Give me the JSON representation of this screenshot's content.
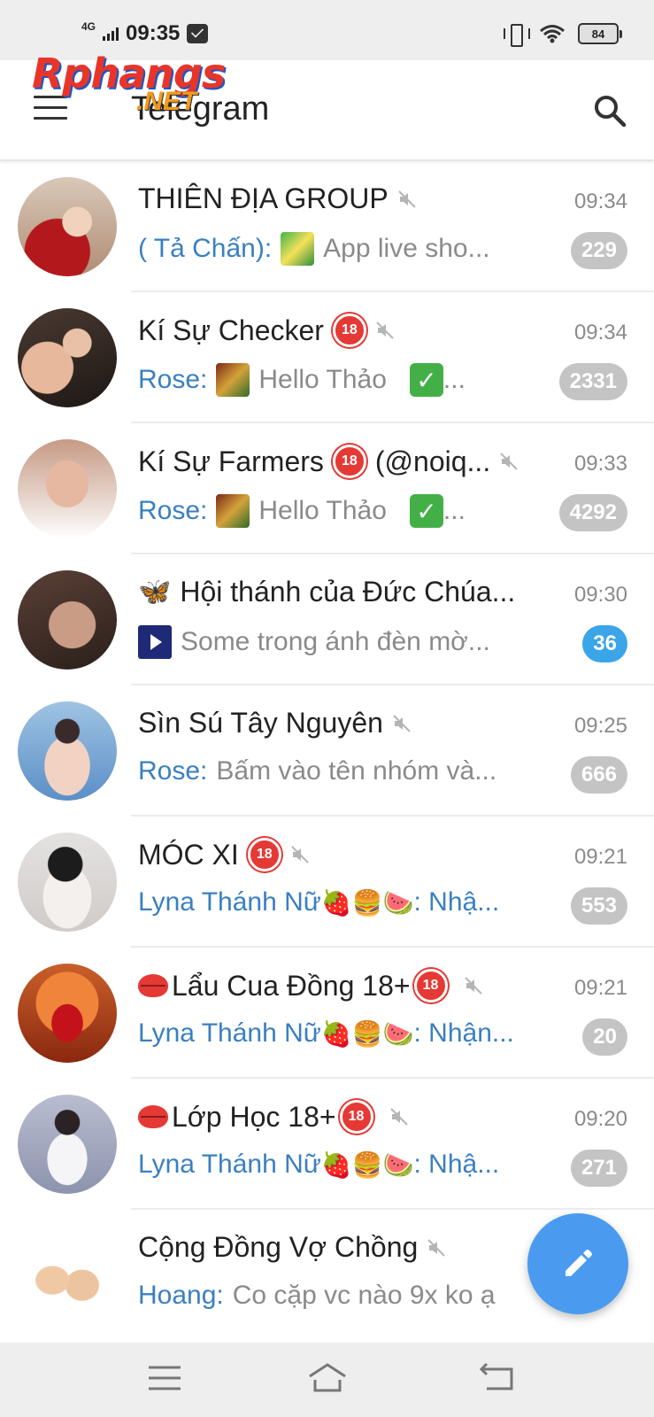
{
  "status_bar": {
    "network": "4G",
    "time": "09:35",
    "battery": "84"
  },
  "watermark": {
    "main": "Rphangs",
    "sub": ".NET"
  },
  "header": {
    "title": "Telegram"
  },
  "colors": {
    "accent": "#3aa5e8",
    "sender": "#3a7fc1",
    "fab": "#4a9bf0",
    "muted_badge": "#c4c4c4"
  },
  "chats": [
    {
      "title": "THIÊN ĐỊA GROUP",
      "time": "09:34",
      "sender": "( Tả Chấn):",
      "message": "App live sho...",
      "badge": "229"
    },
    {
      "title": "Kí Sự Checker",
      "time": "09:34",
      "sender": "Rose:",
      "message": "Hello Thảo",
      "trail": "...",
      "badge": "2331"
    },
    {
      "title": "Kí Sự Farmers",
      "title_suffix": "(@noiq...",
      "time": "09:33",
      "sender": "Rose:",
      "message": "Hello Thảo",
      "trail": "...",
      "badge": "4292"
    },
    {
      "title": "Hội thánh của Đức Chúa...",
      "time": "09:30",
      "sender": "",
      "message": "Some trong ánh đèn mờ...",
      "badge": "36"
    },
    {
      "title": "Sìn Sú Tây Nguyên",
      "time": "09:25",
      "sender": "Rose:",
      "message": "Bấm vào tên nhóm và...",
      "badge": "666"
    },
    {
      "title": "MÓC XI",
      "time": "09:21",
      "sender": "Lyna Thánh Nữ",
      "emojis": "🍓🍔🍉",
      "message": ": Nhậ...",
      "badge": "553"
    },
    {
      "title": "Lẩu Cua Đồng 18+",
      "time": "09:21",
      "sender": "Lyna Thánh Nữ",
      "emojis": "🍓🍔🍉",
      "message": ": Nhận...",
      "badge": "20"
    },
    {
      "title": "Lớp Học 18+",
      "time": "09:20",
      "sender": "Lyna Thánh Nữ",
      "emojis": "🍓🍔🍉",
      "message": ": Nhậ...",
      "badge": "271"
    },
    {
      "title": "Cộng Đồng Vợ Chồng",
      "time": "",
      "sender": "Hoang:",
      "message": "Co cặp vc nào 9x ko ạ",
      "badge": ""
    }
  ],
  "adult_label": "18",
  "icons": {
    "menu": "menu-icon",
    "search": "search-icon",
    "mute": "mute-icon",
    "compose": "pencil-icon",
    "nav_recent": "recent-apps-icon",
    "nav_home": "home-icon",
    "nav_back": "back-icon"
  }
}
